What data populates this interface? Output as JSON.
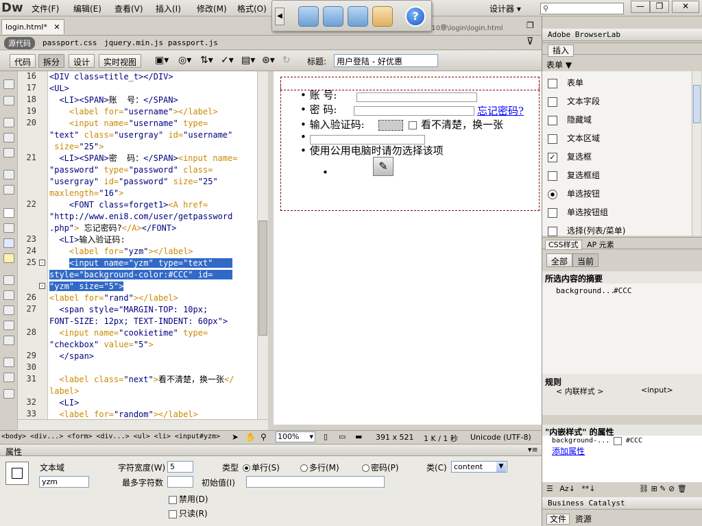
{
  "app": {
    "logo": "Dw",
    "menus": [
      "文件(F)",
      "编辑(E)",
      "查看(V)",
      "插入(I)",
      "修改(M)",
      "格式(O)"
    ],
    "workspace": "设计器",
    "window_buttons": [
      "—",
      "❐",
      "✕"
    ]
  },
  "doc": {
    "tab": "login.html*",
    "path": "¦10章\\login\\login.html",
    "source_label": "源代码",
    "related": [
      "passport.css",
      "jquery.min.js",
      "passport.js"
    ]
  },
  "viewbar": {
    "buttons": [
      "代码",
      "拆分",
      "设计",
      "实时视图"
    ],
    "title_label": "标题:",
    "title_value": "用户登陆 - 好优惠"
  },
  "code": {
    "line_numbers": [
      "16",
      "17",
      "18",
      "19",
      "20",
      "",
      "",
      "21",
      "",
      "",
      "",
      "22",
      "",
      "",
      "23",
      "24",
      "25",
      "",
      "",
      "26",
      "27",
      "",
      "28",
      "",
      "29",
      "30",
      "31",
      "",
      "32",
      "33"
    ]
  },
  "design": {
    "account": "账  号:",
    "password": "密  码:",
    "forgot": "忘记密码?",
    "captcha": "输入验证码:",
    "refresh": "看不清楚，换一张",
    "public_pc": "使用公用电脑时请勿选择该项"
  },
  "tagselector": {
    "tags": "<body> <div...> <form> <div...> <ul> <li> <input#yzm>",
    "zoom": "100%",
    "size": "391 x 521",
    "weight": "1 K / 1 秒",
    "encoding": "Unicode (UTF-8)"
  },
  "props": {
    "panel": "属性",
    "field_label": "文本域",
    "field_name": "yzm",
    "char_width_label": "字符宽度(W)",
    "char_width": "5",
    "max_chars_label": "最多字符数",
    "init_label": "初始值(I)",
    "type_label": "类型",
    "types": [
      "单行(S)",
      "多行(M)",
      "密码(P)"
    ],
    "class_label": "类(C)",
    "class_value": "content",
    "disabled": "禁用(D)",
    "readonly": "只读(R)"
  },
  "right": {
    "browserlab": "Adobe BrowserLab",
    "insert_tab": "插入",
    "category": "表单",
    "insert_items": [
      "表单",
      "文本字段",
      "隐藏域",
      "文本区域",
      "复选框",
      "复选框组",
      "单选按钮",
      "单选按钮组",
      "选择(列表/菜单)"
    ],
    "css_tabs": [
      "CSS样式",
      "AP 元素"
    ],
    "css_sub": [
      "全部",
      "当前"
    ],
    "summary_title": "所选内容的摘要",
    "summary_prop": "background...",
    "summary_val": "#CCC",
    "rules_title": "规则",
    "rule_left": "< 内联样式 >",
    "rule_right": "<input>",
    "props_title": "\"内嵌样式\" 的属性",
    "prop_row": "background-...",
    "prop_val": "#CCC",
    "add_prop": "添加属性",
    "bc": "Business Catalyst",
    "bottom_tabs": [
      "文件",
      "资源"
    ]
  }
}
